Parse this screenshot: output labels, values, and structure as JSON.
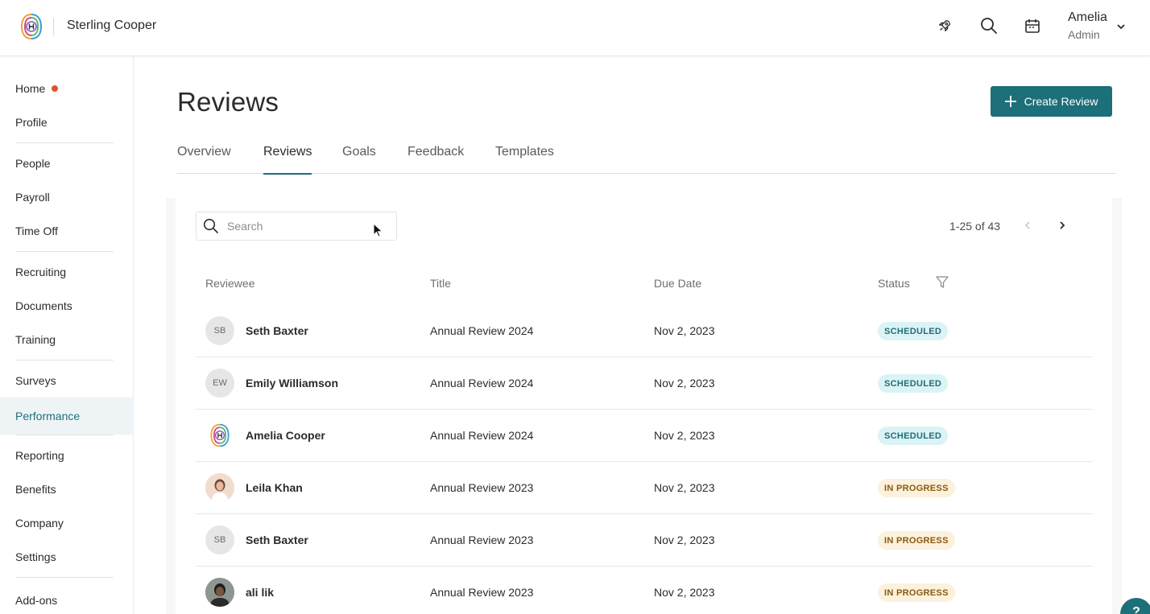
{
  "header": {
    "company": "Sterling Cooper",
    "user_name": "Amelia",
    "user_role": "Admin"
  },
  "sidebar": {
    "items": [
      {
        "label": "Home",
        "has_dot": true
      },
      {
        "label": "Profile"
      },
      {
        "label": "People"
      },
      {
        "label": "Payroll"
      },
      {
        "label": "Time Off"
      },
      {
        "label": "Recruiting"
      },
      {
        "label": "Documents"
      },
      {
        "label": "Training"
      },
      {
        "label": "Surveys"
      },
      {
        "label": "Performance",
        "active": true
      },
      {
        "label": "Reporting"
      },
      {
        "label": "Benefits"
      },
      {
        "label": "Company"
      },
      {
        "label": "Settings"
      },
      {
        "label": "Add-ons"
      }
    ]
  },
  "main": {
    "page_title": "Reviews",
    "create_button": "Create Review",
    "tabs": [
      {
        "label": "Overview"
      },
      {
        "label": "Reviews",
        "active": true
      },
      {
        "label": "Goals"
      },
      {
        "label": "Feedback"
      },
      {
        "label": "Templates"
      }
    ],
    "search_placeholder": "Search",
    "pagination": "1-25 of 43",
    "columns": {
      "reviewee": "Reviewee",
      "title": "Title",
      "due_date": "Due Date",
      "status": "Status"
    },
    "rows": [
      {
        "initials": "SB",
        "avatar": "initials",
        "name": "Seth Baxter",
        "title": "Annual Review 2024",
        "due": "Nov 2, 2023",
        "status": "SCHEDULED",
        "status_type": "scheduled"
      },
      {
        "initials": "EW",
        "avatar": "initials",
        "name": "Emily Williamson",
        "title": "Annual Review 2024",
        "due": "Nov 2, 2023",
        "status": "SCHEDULED",
        "status_type": "scheduled"
      },
      {
        "initials": "",
        "avatar": "logo",
        "name": "Amelia Cooper",
        "title": "Annual Review 2024",
        "due": "Nov 2, 2023",
        "status": "SCHEDULED",
        "status_type": "scheduled"
      },
      {
        "initials": "",
        "avatar": "photo-woman",
        "name": "Leila Khan",
        "title": "Annual Review 2023",
        "due": "Nov 2, 2023",
        "status": "IN PROGRESS",
        "status_type": "progress"
      },
      {
        "initials": "SB",
        "avatar": "initials",
        "name": "Seth Baxter",
        "title": "Annual Review 2023",
        "due": "Nov 2, 2023",
        "status": "IN PROGRESS",
        "status_type": "progress"
      },
      {
        "initials": "",
        "avatar": "photo-man",
        "name": "ali lik",
        "title": "Annual Review 2023",
        "due": "Nov 2, 2023",
        "status": "IN PROGRESS",
        "status_type": "progress"
      }
    ]
  },
  "help_label": "?",
  "colors": {
    "accent": "#1d6f7a",
    "notification_dot": "#e0522c",
    "scheduled_bg": "#dcf3f5",
    "progress_bg": "#fbf1dc"
  }
}
